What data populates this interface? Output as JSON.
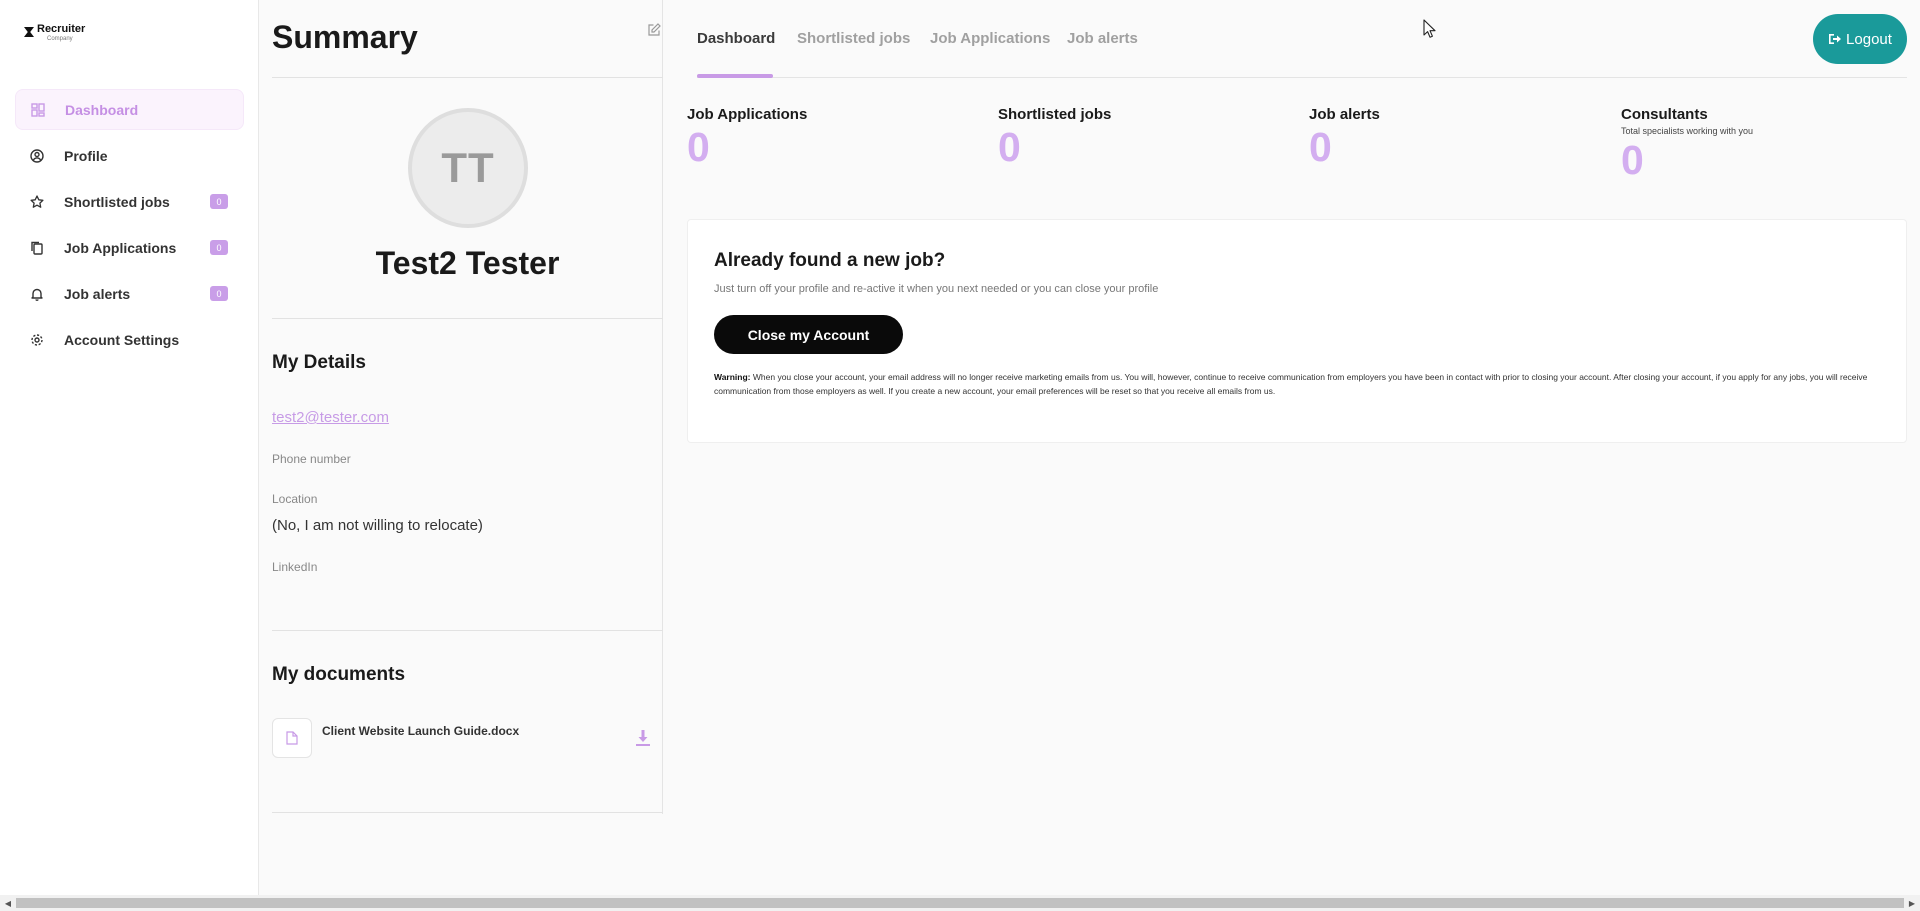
{
  "brand": {
    "name": "Recruiter",
    "sub": "Company"
  },
  "sidebar": {
    "items": [
      {
        "label": "Dashboard",
        "icon": "dashboard-icon",
        "active": true
      },
      {
        "label": "Profile",
        "icon": "user-circle-icon"
      },
      {
        "label": "Shortlisted jobs",
        "icon": "star-icon",
        "badge": "0"
      },
      {
        "label": "Job Applications",
        "icon": "copy-icon",
        "badge": "0"
      },
      {
        "label": "Job alerts",
        "icon": "bell-icon",
        "badge": "0"
      },
      {
        "label": "Account Settings",
        "icon": "gear-icon"
      }
    ]
  },
  "summary": {
    "title": "Summary",
    "initials": "TT",
    "name": "Test2 Tester",
    "details_title": "My Details",
    "email": "test2@tester.com",
    "phone_label": "Phone number",
    "location_label": "Location",
    "location_value": "(No, I am not willing to relocate)",
    "linkedin_label": "LinkedIn",
    "documents_title": "My documents",
    "document_name": "Client Website Launch Guide.docx"
  },
  "tabs": [
    "Dashboard",
    "Shortlisted jobs",
    "Job Applications",
    "Job alerts"
  ],
  "logout_label": "Logout",
  "stats": [
    {
      "label": "Job Applications",
      "value": "0"
    },
    {
      "label": "Shortlisted jobs",
      "value": "0"
    },
    {
      "label": "Job alerts",
      "value": "0"
    },
    {
      "label": "Consultants",
      "sub": "Total specialists working with you",
      "value": "0"
    }
  ],
  "close_card": {
    "title": "Already found a new job?",
    "subtitle": "Just turn off your profile and re-active it when you next needed or you can close your profile",
    "button": "Close my Account",
    "warning_label": "Warning:",
    "warning_text": " When you close your account, your email address will no longer receive marketing emails from us. You will, however, continue to receive communication from employers you have been in contact with prior to closing your account. After closing your account, if you apply for any jobs, you will receive communication from those employers as well. If you create a new account, your email preferences will be reset so that you receive all emails from us."
  },
  "colors": {
    "accent": "#c89ae6",
    "logout": "#1a9a9a",
    "stat_value": "#d3aef0"
  }
}
